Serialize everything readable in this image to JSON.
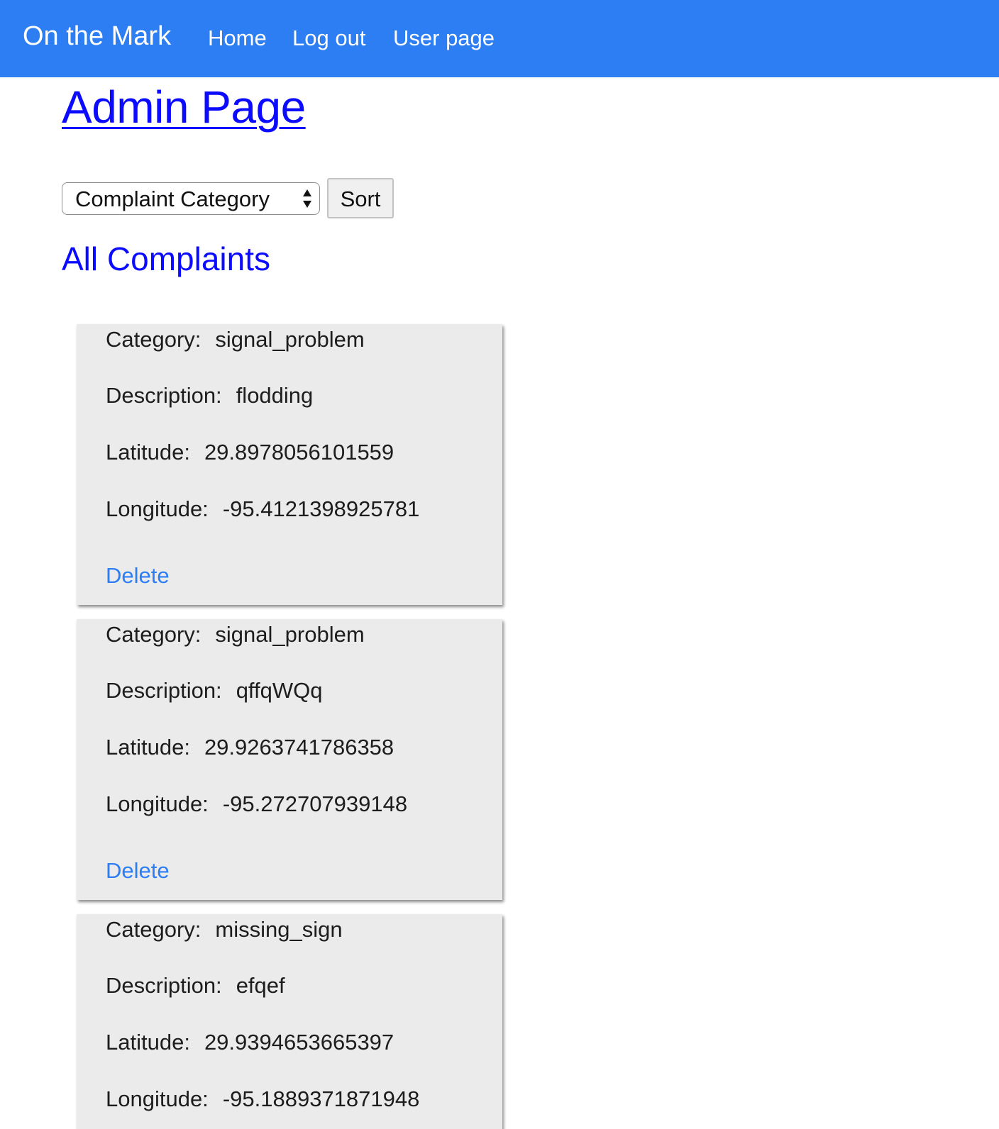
{
  "navbar": {
    "brand": "On the Mark",
    "links": [
      "Home",
      "Log out",
      "User page"
    ]
  },
  "page": {
    "title": "Admin Page",
    "section_title": "All Complaints"
  },
  "sort": {
    "selected": "Complaint Category",
    "button_label": "Sort"
  },
  "labels": {
    "category": "Category:",
    "description": "Description:",
    "latitude": "Latitude:",
    "longitude": "Longitude:",
    "delete": "Delete"
  },
  "complaints": [
    {
      "category": "signal_problem",
      "description": "flodding",
      "latitude": "29.8978056101559",
      "longitude": "-95.4121398925781"
    },
    {
      "category": "signal_problem",
      "description": "qffqWQq",
      "latitude": "29.9263741786358",
      "longitude": "-95.272707939148"
    },
    {
      "category": "missing_sign",
      "description": "efqef",
      "latitude": "29.9394653665397",
      "longitude": "-95.1889371871948"
    }
  ],
  "colors": {
    "navbar": "#2e7ef3",
    "heading": "#0b0bff",
    "link": "#2e7ef3",
    "card": "#ebebeb"
  }
}
